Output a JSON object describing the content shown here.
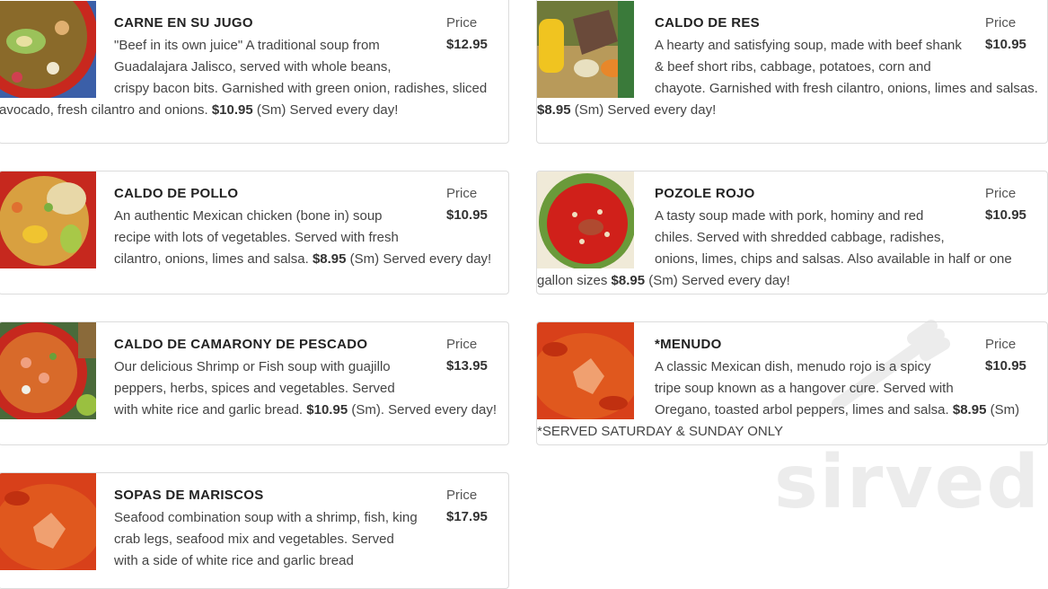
{
  "price_heading": "Price",
  "watermark_text": "sirved",
  "items": [
    {
      "name": "CARNE EN SU JUGO",
      "price": "$12.95",
      "desc_before": "\"Beef in its own juice\" A traditional soup from Guadalajara Jalisco, served with whole beans, crispy bacon bits. Garnished with green onion, radishes, sliced avocado, fresh cilantro and onions. ",
      "small_price": "$10.95",
      "desc_after": " (Sm) Served every day!"
    },
    {
      "name": "CALDO DE RES",
      "price": "$10.95",
      "desc_before": "A hearty and satisfying soup, made with beef shank & beef short ribs, cabbage, potatoes, corn and chayote. Garnished with fresh cilantro, onions, limes and salsas. ",
      "small_price": "$8.95",
      "desc_after": " (Sm)  Served every day!"
    },
    {
      "name": "CALDO DE POLLO",
      "price": "$10.95",
      "desc_before": "An authentic Mexican chicken (bone in) soup recipe with lots of vegetables. Served with fresh cilantro, onions, limes and salsa. ",
      "small_price": "$8.95",
      "desc_after": " (Sm) Served every day!"
    },
    {
      "name": "POZOLE ROJO",
      "price": "$10.95",
      "desc_before": "A tasty soup made with pork, hominy and red chiles. Served with shredded cabbage, radishes, onions, limes, chips and salsas. Also available in half  or one gallon sizes ",
      "small_price": "$8.95",
      "desc_after": " (Sm)  Served every day!"
    },
    {
      "name": "CALDO DE CAMARONY DE PESCADO",
      "price": "$13.95",
      "desc_before": "Our delicious  Shrimp  or Fish soup with guajillo peppers, herbs, spices and vegetables. Served with white rice and garlic bread. ",
      "small_price": "$10.95",
      "desc_after": " (Sm). Served every day!"
    },
    {
      "name": "*MENUDO",
      "price": "$10.95",
      "desc_before": "A classic Mexican dish, menudo rojo is a spicy tripe soup known as a hangover cure. Served with Oregano, toasted arbol peppers, limes and salsa. ",
      "small_price": "$8.95",
      "desc_after": " (Sm)  *SERVED SATURDAY & SUNDAY ONLY"
    },
    {
      "name": "SOPAS DE MARISCOS",
      "price": "$17.95",
      "desc_before": "Seafood combination soup with a shrimp, fish, king crab legs, seafood mix and vegetables. Served with a side of white rice and garlic bread",
      "small_price": "",
      "desc_after": ""
    }
  ]
}
